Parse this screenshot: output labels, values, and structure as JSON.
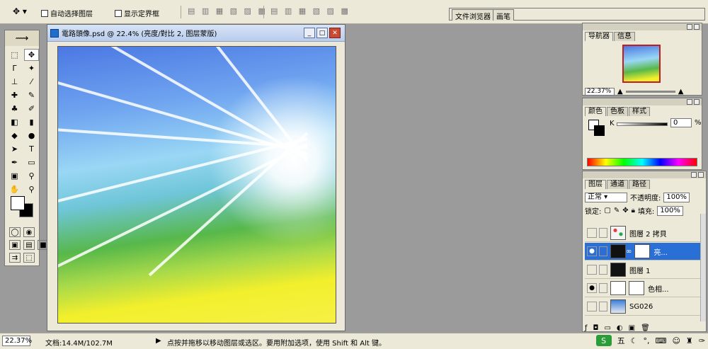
{
  "options_bar": {
    "auto_select_label": "自动选择图层",
    "show_bounds_label": "显示定界框",
    "tabs": [
      "文件浏览器",
      "画笔"
    ]
  },
  "document": {
    "title": "電路頭像.psd @ 22.4% (亮度/對比 2, 图层蒙版)",
    "zoom": "22.37%",
    "doc_info": "文档:14.4M/102.7M",
    "status_hint": "点按并拖移以移动图层或选区。要用附加选项，使用 Shift 和 Alt 键。"
  },
  "navigator": {
    "tabs": [
      "导航器",
      "信息"
    ],
    "zoom": "22.37%"
  },
  "color_panel": {
    "tabs": [
      "颜色",
      "色板",
      "样式"
    ],
    "k_label": "K",
    "k_value": "0",
    "pct": "%"
  },
  "layers_panel": {
    "tabs": [
      "图层",
      "通道",
      "路径"
    ],
    "blend_mode": "正常",
    "opacity_label": "不透明度:",
    "opacity_value": "100%",
    "lock_label": "锁定:",
    "fill_label": "填充:",
    "fill_value": "100%",
    "layers": [
      {
        "name": "图層 2 拷貝",
        "visible": false,
        "thumb": "dot"
      },
      {
        "name": "亮...",
        "visible": true,
        "thumb": "dark",
        "active": true
      },
      {
        "name": "图層 1",
        "visible": false,
        "thumb": "dark"
      },
      {
        "name": "色相...",
        "visible": true,
        "thumb": "white"
      },
      {
        "name": "SG026",
        "visible": false,
        "thumb": "sky"
      }
    ]
  },
  "tray": {
    "ime": "五"
  }
}
